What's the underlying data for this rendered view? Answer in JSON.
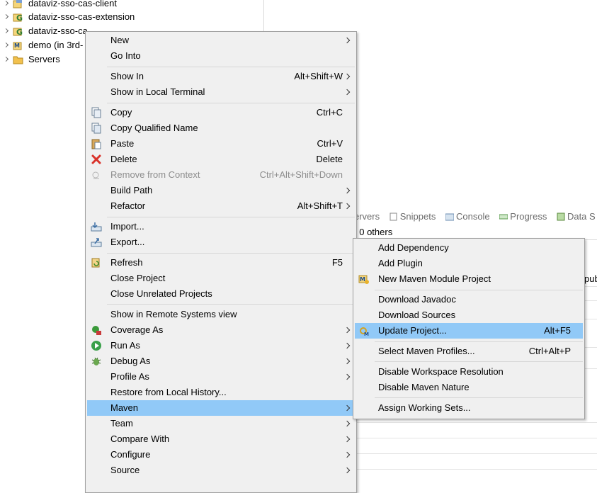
{
  "explorer": {
    "items": [
      {
        "label": "dataviz-sso-cas-client",
        "icon": "java-project-icon"
      },
      {
        "label": "dataviz-sso-cas-extension",
        "icon": "gradle-project-icon"
      },
      {
        "label": "dataviz-sso-ca",
        "icon": "gradle-project-icon"
      },
      {
        "label": "demo (in 3rd-",
        "icon": "maven-project-icon"
      },
      {
        "label": "Servers",
        "icon": "folder-icon"
      }
    ]
  },
  "views": {
    "tabs": [
      "ervers",
      "Snippets",
      "Console",
      "Progress",
      "Data S"
    ],
    "status": ", 0 others",
    "clipped_text": "pub"
  },
  "main_menu": {
    "items": [
      {
        "label": "New",
        "shortcut": "",
        "submenu": true
      },
      {
        "label": "Go Into",
        "shortcut": "",
        "submenu": false
      },
      {
        "label": "Show In",
        "shortcut": "Alt+Shift+W",
        "submenu": true
      },
      {
        "label": "Show in Local Terminal",
        "shortcut": "",
        "submenu": true
      },
      {
        "label": "Copy",
        "shortcut": "Ctrl+C",
        "submenu": false
      },
      {
        "label": "Copy Qualified Name",
        "shortcut": "",
        "submenu": false
      },
      {
        "label": "Paste",
        "shortcut": "Ctrl+V",
        "submenu": false
      },
      {
        "label": "Delete",
        "shortcut": "Delete",
        "submenu": false
      },
      {
        "label": "Remove from Context",
        "shortcut": "Ctrl+Alt+Shift+Down",
        "submenu": false
      },
      {
        "label": "Build Path",
        "shortcut": "",
        "submenu": true
      },
      {
        "label": "Refactor",
        "shortcut": "Alt+Shift+T",
        "submenu": true
      },
      {
        "label": "Import...",
        "shortcut": "",
        "submenu": false
      },
      {
        "label": "Export...",
        "shortcut": "",
        "submenu": false
      },
      {
        "label": "Refresh",
        "shortcut": "F5",
        "submenu": false
      },
      {
        "label": "Close Project",
        "shortcut": "",
        "submenu": false
      },
      {
        "label": "Close Unrelated Projects",
        "shortcut": "",
        "submenu": false
      },
      {
        "label": "Show in Remote Systems view",
        "shortcut": "",
        "submenu": false
      },
      {
        "label": "Coverage As",
        "shortcut": "",
        "submenu": true
      },
      {
        "label": "Run As",
        "shortcut": "",
        "submenu": true
      },
      {
        "label": "Debug As",
        "shortcut": "",
        "submenu": true
      },
      {
        "label": "Profile As",
        "shortcut": "",
        "submenu": true
      },
      {
        "label": "Restore from Local History...",
        "shortcut": "",
        "submenu": false
      },
      {
        "label": "Maven",
        "shortcut": "",
        "submenu": true
      },
      {
        "label": "Team",
        "shortcut": "",
        "submenu": true
      },
      {
        "label": "Compare With",
        "shortcut": "",
        "submenu": true
      },
      {
        "label": "Configure",
        "shortcut": "",
        "submenu": true
      },
      {
        "label": "Source",
        "shortcut": "",
        "submenu": true
      }
    ]
  },
  "maven_menu": {
    "items": [
      {
        "label": "Add Dependency",
        "shortcut": ""
      },
      {
        "label": "Add Plugin",
        "shortcut": ""
      },
      {
        "label": "New Maven Module Project",
        "shortcut": ""
      },
      {
        "label": "Download Javadoc",
        "shortcut": ""
      },
      {
        "label": "Download Sources",
        "shortcut": ""
      },
      {
        "label": "Update Project...",
        "shortcut": "Alt+F5"
      },
      {
        "label": "Select Maven Profiles...",
        "shortcut": "Ctrl+Alt+P"
      },
      {
        "label": "Disable Workspace Resolution",
        "shortcut": ""
      },
      {
        "label": "Disable Maven Nature",
        "shortcut": ""
      },
      {
        "label": "Assign Working Sets...",
        "shortcut": ""
      }
    ]
  },
  "colors": {
    "selection": "#91c9f7",
    "menu_bg": "#f0f0f0",
    "disabled_text": "#8d8d8d"
  }
}
